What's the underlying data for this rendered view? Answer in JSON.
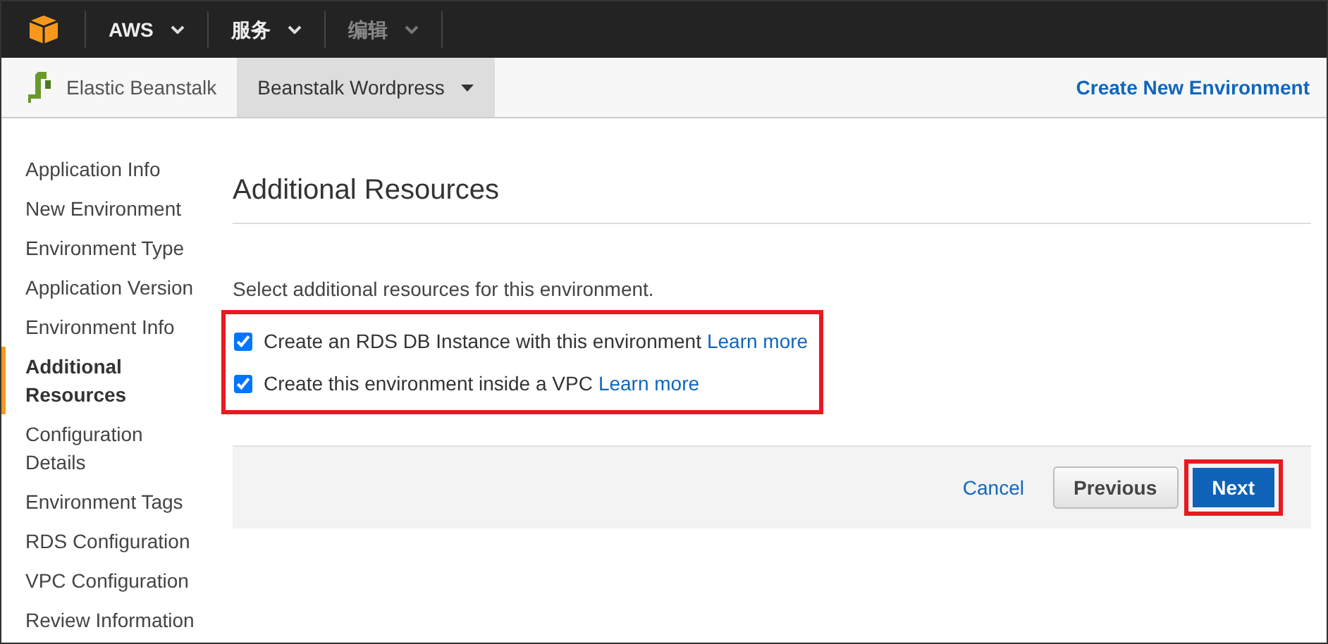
{
  "top_nav": [
    {
      "label": "AWS",
      "disabled": false
    },
    {
      "label": "服务",
      "disabled": false
    },
    {
      "label": "编辑",
      "disabled": true
    }
  ],
  "sub_nav": {
    "brand": "Elastic Beanstalk",
    "app": "Beanstalk Wordpress",
    "action": "Create New Environment"
  },
  "sidebar": {
    "items": [
      {
        "label": "Application Info",
        "selected": false
      },
      {
        "label": "New Environment",
        "selected": false
      },
      {
        "label": "Environment Type",
        "selected": false
      },
      {
        "label": "Application Version",
        "selected": false
      },
      {
        "label": "Environment Info",
        "selected": false
      },
      {
        "label": "Additional Resources",
        "selected": true
      },
      {
        "label": "Configuration Details",
        "selected": false
      },
      {
        "label": "Environment Tags",
        "selected": false
      },
      {
        "label": "RDS Configuration",
        "selected": false
      },
      {
        "label": "VPC Configuration",
        "selected": false
      },
      {
        "label": "Review Information",
        "selected": false
      }
    ]
  },
  "page": {
    "title": "Additional Resources",
    "intro": "Select additional resources for this environment.",
    "options": [
      {
        "label": "Create an RDS DB Instance with this environment",
        "link": "Learn more",
        "checked": true
      },
      {
        "label": "Create this environment inside a VPC",
        "link": "Learn more",
        "checked": true
      }
    ],
    "options_highlighted": true
  },
  "footer": {
    "cancel": "Cancel",
    "previous": "Previous",
    "next": "Next",
    "next_highlighted": true
  }
}
